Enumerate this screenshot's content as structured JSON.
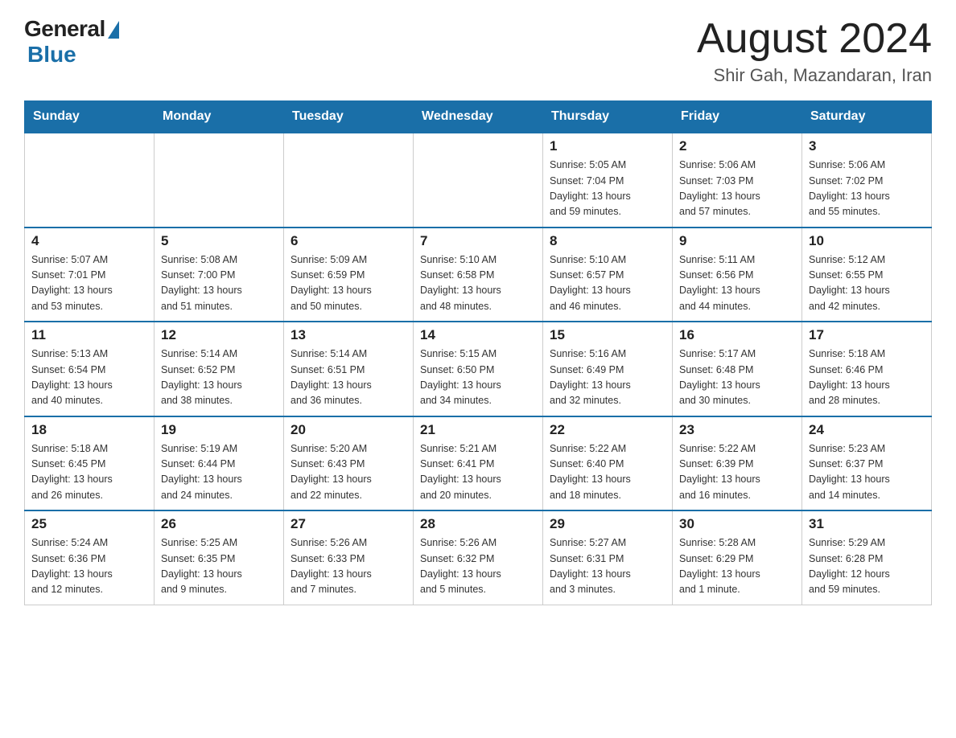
{
  "header": {
    "logo_general": "General",
    "logo_blue": "Blue",
    "month_year": "August 2024",
    "location": "Shir Gah, Mazandaran, Iran"
  },
  "days_of_week": [
    "Sunday",
    "Monday",
    "Tuesday",
    "Wednesday",
    "Thursday",
    "Friday",
    "Saturday"
  ],
  "weeks": [
    [
      {
        "day": "",
        "info": ""
      },
      {
        "day": "",
        "info": ""
      },
      {
        "day": "",
        "info": ""
      },
      {
        "day": "",
        "info": ""
      },
      {
        "day": "1",
        "info": "Sunrise: 5:05 AM\nSunset: 7:04 PM\nDaylight: 13 hours\nand 59 minutes."
      },
      {
        "day": "2",
        "info": "Sunrise: 5:06 AM\nSunset: 7:03 PM\nDaylight: 13 hours\nand 57 minutes."
      },
      {
        "day": "3",
        "info": "Sunrise: 5:06 AM\nSunset: 7:02 PM\nDaylight: 13 hours\nand 55 minutes."
      }
    ],
    [
      {
        "day": "4",
        "info": "Sunrise: 5:07 AM\nSunset: 7:01 PM\nDaylight: 13 hours\nand 53 minutes."
      },
      {
        "day": "5",
        "info": "Sunrise: 5:08 AM\nSunset: 7:00 PM\nDaylight: 13 hours\nand 51 minutes."
      },
      {
        "day": "6",
        "info": "Sunrise: 5:09 AM\nSunset: 6:59 PM\nDaylight: 13 hours\nand 50 minutes."
      },
      {
        "day": "7",
        "info": "Sunrise: 5:10 AM\nSunset: 6:58 PM\nDaylight: 13 hours\nand 48 minutes."
      },
      {
        "day": "8",
        "info": "Sunrise: 5:10 AM\nSunset: 6:57 PM\nDaylight: 13 hours\nand 46 minutes."
      },
      {
        "day": "9",
        "info": "Sunrise: 5:11 AM\nSunset: 6:56 PM\nDaylight: 13 hours\nand 44 minutes."
      },
      {
        "day": "10",
        "info": "Sunrise: 5:12 AM\nSunset: 6:55 PM\nDaylight: 13 hours\nand 42 minutes."
      }
    ],
    [
      {
        "day": "11",
        "info": "Sunrise: 5:13 AM\nSunset: 6:54 PM\nDaylight: 13 hours\nand 40 minutes."
      },
      {
        "day": "12",
        "info": "Sunrise: 5:14 AM\nSunset: 6:52 PM\nDaylight: 13 hours\nand 38 minutes."
      },
      {
        "day": "13",
        "info": "Sunrise: 5:14 AM\nSunset: 6:51 PM\nDaylight: 13 hours\nand 36 minutes."
      },
      {
        "day": "14",
        "info": "Sunrise: 5:15 AM\nSunset: 6:50 PM\nDaylight: 13 hours\nand 34 minutes."
      },
      {
        "day": "15",
        "info": "Sunrise: 5:16 AM\nSunset: 6:49 PM\nDaylight: 13 hours\nand 32 minutes."
      },
      {
        "day": "16",
        "info": "Sunrise: 5:17 AM\nSunset: 6:48 PM\nDaylight: 13 hours\nand 30 minutes."
      },
      {
        "day": "17",
        "info": "Sunrise: 5:18 AM\nSunset: 6:46 PM\nDaylight: 13 hours\nand 28 minutes."
      }
    ],
    [
      {
        "day": "18",
        "info": "Sunrise: 5:18 AM\nSunset: 6:45 PM\nDaylight: 13 hours\nand 26 minutes."
      },
      {
        "day": "19",
        "info": "Sunrise: 5:19 AM\nSunset: 6:44 PM\nDaylight: 13 hours\nand 24 minutes."
      },
      {
        "day": "20",
        "info": "Sunrise: 5:20 AM\nSunset: 6:43 PM\nDaylight: 13 hours\nand 22 minutes."
      },
      {
        "day": "21",
        "info": "Sunrise: 5:21 AM\nSunset: 6:41 PM\nDaylight: 13 hours\nand 20 minutes."
      },
      {
        "day": "22",
        "info": "Sunrise: 5:22 AM\nSunset: 6:40 PM\nDaylight: 13 hours\nand 18 minutes."
      },
      {
        "day": "23",
        "info": "Sunrise: 5:22 AM\nSunset: 6:39 PM\nDaylight: 13 hours\nand 16 minutes."
      },
      {
        "day": "24",
        "info": "Sunrise: 5:23 AM\nSunset: 6:37 PM\nDaylight: 13 hours\nand 14 minutes."
      }
    ],
    [
      {
        "day": "25",
        "info": "Sunrise: 5:24 AM\nSunset: 6:36 PM\nDaylight: 13 hours\nand 12 minutes."
      },
      {
        "day": "26",
        "info": "Sunrise: 5:25 AM\nSunset: 6:35 PM\nDaylight: 13 hours\nand 9 minutes."
      },
      {
        "day": "27",
        "info": "Sunrise: 5:26 AM\nSunset: 6:33 PM\nDaylight: 13 hours\nand 7 minutes."
      },
      {
        "day": "28",
        "info": "Sunrise: 5:26 AM\nSunset: 6:32 PM\nDaylight: 13 hours\nand 5 minutes."
      },
      {
        "day": "29",
        "info": "Sunrise: 5:27 AM\nSunset: 6:31 PM\nDaylight: 13 hours\nand 3 minutes."
      },
      {
        "day": "30",
        "info": "Sunrise: 5:28 AM\nSunset: 6:29 PM\nDaylight: 13 hours\nand 1 minute."
      },
      {
        "day": "31",
        "info": "Sunrise: 5:29 AM\nSunset: 6:28 PM\nDaylight: 12 hours\nand 59 minutes."
      }
    ]
  ]
}
